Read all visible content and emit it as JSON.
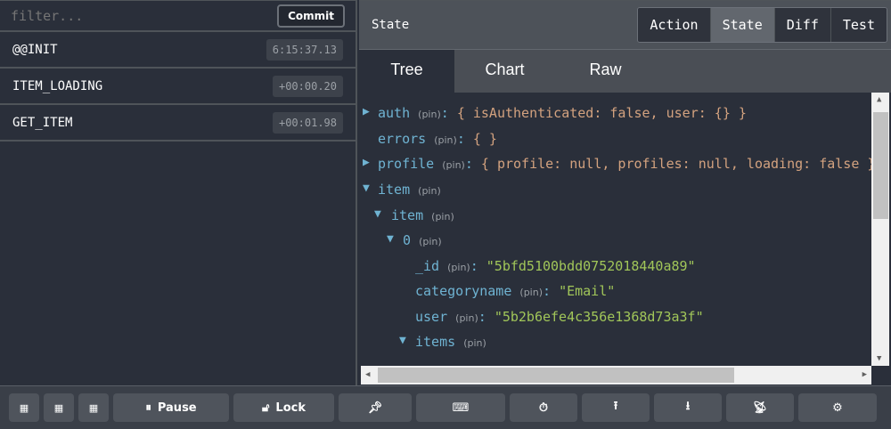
{
  "filter": {
    "placeholder": "filter...",
    "commit": "Commit"
  },
  "actions": [
    {
      "name": "@@INIT",
      "time": "6:15:37.13"
    },
    {
      "name": "ITEM_LOADING",
      "time": "+00:00.20"
    },
    {
      "name": "GET_ITEM",
      "time": "+00:01.98"
    }
  ],
  "header": {
    "title": "State",
    "tabs": [
      "Action",
      "State",
      "Diff",
      "Test"
    ],
    "active": "State"
  },
  "viewtabs": [
    "Tree",
    "Chart",
    "Raw"
  ],
  "tree": {
    "pin": "(pin)",
    "auth_key": "auth",
    "auth_val": "{ isAuthenticated: false, user: {} }",
    "errors_key": "errors",
    "errors_val": "{ }",
    "profile_key": "profile",
    "profile_val": "{ profile: null, profiles: null, loading: false }",
    "item_key": "item",
    "item2_key": "item",
    "zero_key": "0",
    "id_key": "_id",
    "id_val": "\"5bfd5100bdd0752018440a89\"",
    "cat_key": "categoryname",
    "cat_val": "\"Email\"",
    "user_key": "user",
    "user_val": "\"5b2b6efe4c356e1368d73a3f\"",
    "items_key": "items"
  },
  "toolbar": {
    "pause": "Pause",
    "lock": "Lock"
  }
}
